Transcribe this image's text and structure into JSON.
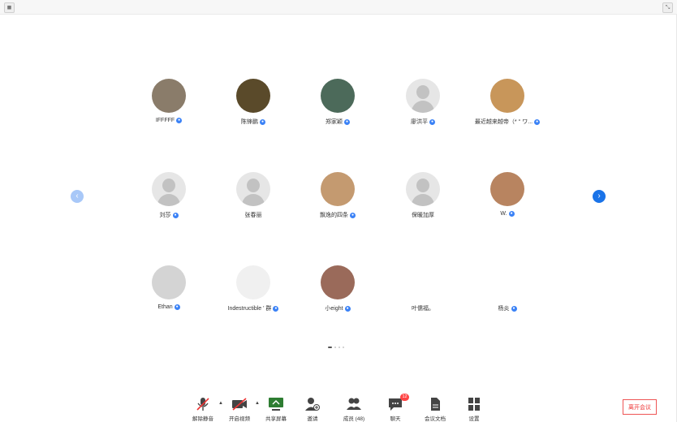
{
  "participants": [
    {
      "name": "IFFFFF",
      "mic": true,
      "color": "#8a7c6a"
    },
    {
      "name": "陈锋鹏",
      "mic": true,
      "color": "#5a4a2a"
    },
    {
      "name": "郑家颖",
      "mic": true,
      "color": "#4c6a5a"
    },
    {
      "name": "廖洪平",
      "mic": true,
      "color": ""
    },
    {
      "name": "最近越来越帝（* ° ワ...",
      "mic": true,
      "color": "#c8965a"
    },
    {
      "name": "刘莎",
      "mic": true,
      "color": ""
    },
    {
      "name": "张春丽",
      "mic": false,
      "color": ""
    },
    {
      "name": "飘逸的四条",
      "mic": true,
      "color": "#c49a70"
    },
    {
      "name": "保暖加厚",
      "mic": false,
      "color": ""
    },
    {
      "name": "W.",
      "mic": true,
      "color": "#b88460"
    },
    {
      "name": "Ethan",
      "mic": true,
      "color": "#d4d4d4"
    },
    {
      "name": "Indestructible ' 群",
      "mic": true,
      "color": "#f0f0f0"
    },
    {
      "name": "小eight",
      "mic": true,
      "color": "#9a6a5a"
    },
    {
      "name": "叶儒福。",
      "mic": false,
      "color": "#ffffff"
    },
    {
      "name": "杨炎",
      "mic": true,
      "color": "#ffffff"
    }
  ],
  "toolbar": {
    "unmute": "解除静音",
    "start_video": "开启视频",
    "share_screen": "共享屏幕",
    "invite": "邀请",
    "members": "成员 (48)",
    "chat": "聊天",
    "chat_badge": "12",
    "docs": "会议文档",
    "settings": "设置"
  },
  "leave": "离开会议",
  "colors": {
    "accent": "#1a73e8",
    "danger": "#e53935"
  }
}
